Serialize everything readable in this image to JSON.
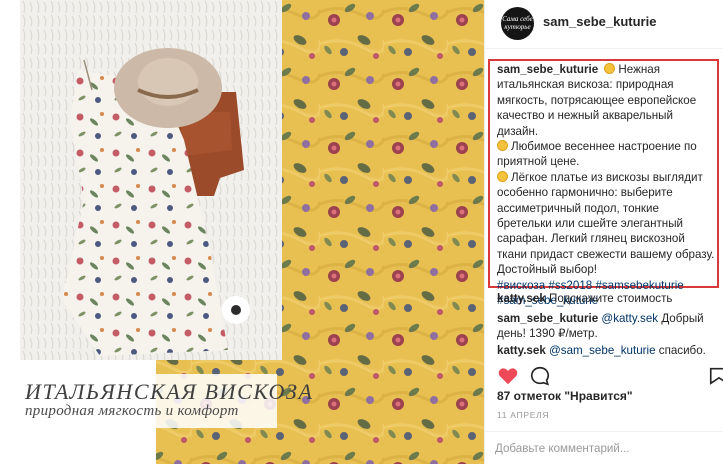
{
  "photo": {
    "overlay_title": "ИТАЛЬЯНСКАЯ ВИСКОЗА",
    "overlay_subtitle": "природная мягкость и комфорт"
  },
  "post": {
    "username": "sam_sebe_kuturie",
    "avatar_text": "Сама себе кутюрье",
    "caption": {
      "username": "sam_sebe_kuturie",
      "p1": "Нежная итальянская вискоза: природная мягкость, потрясающее европейское качество и нежный акварельный дизайн.",
      "p2": "Любимое весеннее настроение по приятной цене.",
      "p3": "Лёгкое платье из вискозы выглядит особенно гармонично: выберите ассиметричный подол, тонкие бретельки или сшейте элегантный сарафан. Легкий глянец вискозной ткани придаст свежести вашему образу. Достойный выбор!",
      "hashtags": "#вискоза #ss2018 #samsebekuturie #sam_sebe_kuturie",
      "emoji_icon": "sunflower-emoji"
    },
    "comments": [
      {
        "username": "katty.sek",
        "text": "Подскажите стоимость"
      },
      {
        "username": "sam_sebe_kuturie",
        "mention": "@katty.sek",
        "text": "Добрый день! 1390 ₽/метр."
      },
      {
        "username": "katty.sek",
        "mention": "@sam_sebe_kuturie",
        "text": "спасибо."
      }
    ],
    "likes": "87 отметок \"Нравится\"",
    "date": "11 АПРЕЛЯ",
    "add_comment_placeholder": "Добавьте комментарий...",
    "icons": [
      "heart-icon",
      "comment-icon",
      "share-icon"
    ],
    "colors": {
      "like_heart": "#ed4956",
      "hashtag": "#003569",
      "highlight_border": "#d9393b",
      "muted": "#999999"
    }
  }
}
